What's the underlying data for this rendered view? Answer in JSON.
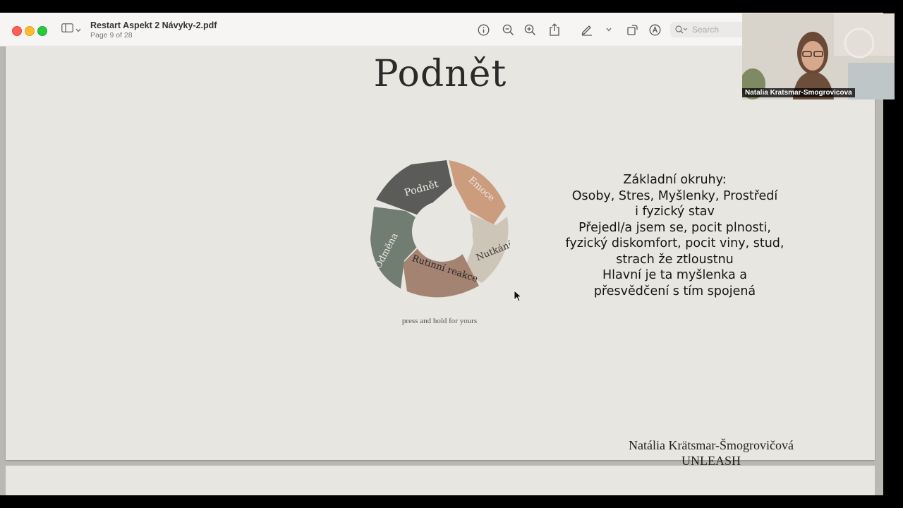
{
  "window": {
    "title": "Restart Aspekt 2 Návyky-2.pdf",
    "subtitle": "Page 9 of 28"
  },
  "toolbar": {
    "search_placeholder": "Search",
    "icons": [
      "sidebar-icon",
      "chevron-down-icon",
      "info-icon",
      "zoom-out-icon",
      "zoom-in-icon",
      "share-icon",
      "markup-pen-icon",
      "chevron-down-icon",
      "rotate-icon",
      "annotate-icon",
      "search-icon"
    ]
  },
  "slide": {
    "title": "Podnět",
    "cycle": {
      "segments": [
        {
          "label": "Podnět",
          "color": "#5b5c5a"
        },
        {
          "label": "Emoce",
          "color": "#cc9c7e"
        },
        {
          "label": "Nutkání",
          "color": "#cdc5b8"
        },
        {
          "label": "Rutinní reakce",
          "color": "#a58373"
        },
        {
          "label": "Odměna",
          "color": "#727d72"
        }
      ],
      "caption": "press and hold for yours"
    },
    "body_lines": [
      "Základní okruhy:",
      "Osoby, Stres, Myšlenky, Prostředí",
      "i fyzický stav",
      "Přejedl/a jsem se, pocit plnosti,",
      "fyzický diskomfort, pocit viny, stud,",
      "strach že ztloustnu",
      "Hlavní je ta myšlenka a",
      "přesvědčení s tím spojená"
    ],
    "author_name": "Natália Krätsmar-Šmogrovičová",
    "author_brand": "UNLEASH"
  },
  "webcam": {
    "participant_name": "Natalia Kratsmar-Smogrovicova"
  }
}
